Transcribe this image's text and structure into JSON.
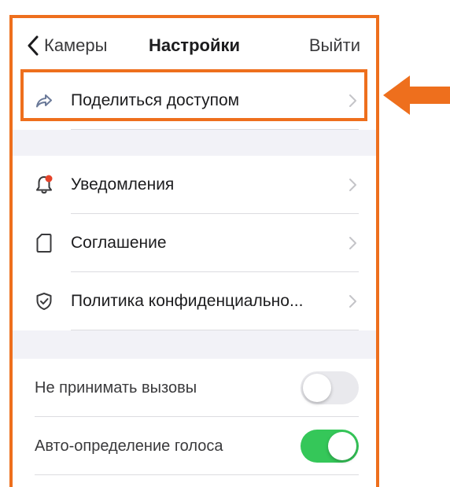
{
  "nav": {
    "back_label": "Камеры",
    "title": "Настройки",
    "logout_label": "Выйти"
  },
  "groups": [
    {
      "items": [
        {
          "label": "Поделиться доступом",
          "icon": "share-arrow-icon"
        }
      ]
    },
    {
      "items": [
        {
          "label": "Уведомления",
          "icon": "bell-icon",
          "badge_color": "#e5432a"
        },
        {
          "label": "Соглашение",
          "icon": "document-icon"
        },
        {
          "label": "Политика конфиденциально...",
          "icon": "shield-check-icon"
        }
      ]
    },
    {
      "items": [
        {
          "label": "Не принимать вызовы",
          "toggle": "off"
        },
        {
          "label": "Авто-определение голоса",
          "toggle": "on"
        }
      ]
    }
  ],
  "colors": {
    "accent_orange": "#ee6f1d",
    "toggle_on": "#35c759",
    "toggle_off": "#e9e9ed",
    "background": "#f2f2f7"
  }
}
